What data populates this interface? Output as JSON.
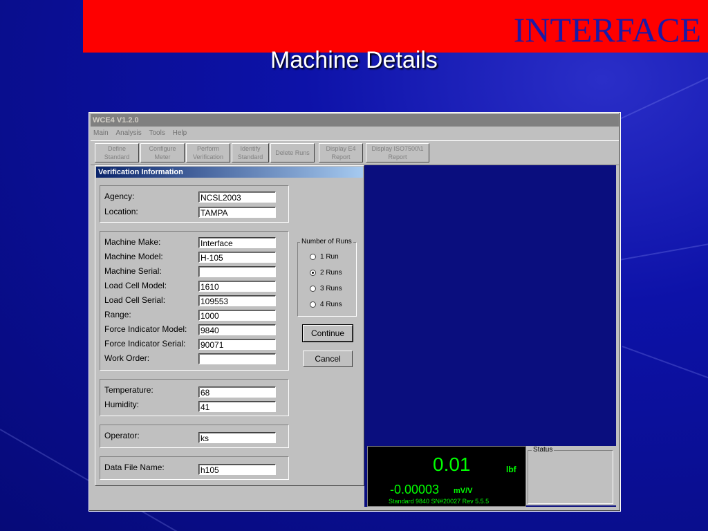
{
  "slide": {
    "brand": "INTERFACE",
    "title": "Machine Details"
  },
  "window": {
    "title": "WCE4 V1.2.0",
    "menu": [
      "Main",
      "Analysis",
      "Tools",
      "Help"
    ],
    "toolbar": [
      "Define\nStandard",
      "Configure\nMeter",
      "Perform\nVerification",
      "Identify\nStandard",
      "Delete Runs",
      "Display E4\nReport",
      "Display ISO7500\\1\nReport"
    ]
  },
  "panel": {
    "title": "Verification Information",
    "agency": {
      "label": "Agency:",
      "value": "NCSL2003"
    },
    "location": {
      "label": "Location:",
      "value": "TAMPA"
    },
    "machine_make": {
      "label": "Machine Make:",
      "value": "Interface"
    },
    "machine_model": {
      "label": "Machine Model:",
      "value": "H-105"
    },
    "machine_serial": {
      "label": "Machine Serial:",
      "value": ""
    },
    "load_cell_model": {
      "label": "Load Cell Model:",
      "value": "1610"
    },
    "load_cell_serial": {
      "label": "Load Cell Serial:",
      "value": "109553"
    },
    "range": {
      "label": "Range:",
      "value": "1000"
    },
    "force_indicator_model": {
      "label": "Force Indicator Model:",
      "value": "9840"
    },
    "force_indicator_serial": {
      "label": "Force Indicator Serial:",
      "value": "90071"
    },
    "work_order": {
      "label": "Work Order:",
      "value": ""
    },
    "temperature": {
      "label": "Temperature:",
      "value": "68"
    },
    "humidity": {
      "label": "Humidity:",
      "value": "41"
    },
    "operator": {
      "label": "Operator:",
      "value": "ks"
    },
    "data_file": {
      "label": "Data File Name:",
      "value": "h105"
    },
    "runs": {
      "legend": "Number of Runs",
      "options": [
        "1 Run",
        "2 Runs",
        "3 Runs",
        "4 Runs"
      ],
      "selected": "2 Runs"
    },
    "continue_label": "Continue",
    "cancel_label": "Cancel"
  },
  "readout": {
    "force_value": "0.01",
    "force_unit": "lbf",
    "signal_value": "-0.00003",
    "signal_unit": "mV/V",
    "info": "Standard 9840 SN#20027 Rev 5.5.5",
    "value_color": "#00ff00"
  },
  "status": {
    "legend": "Status"
  },
  "colors": {
    "brand_bar": "#fe0000",
    "brand_text": "#1a1aa6",
    "slide_bg": "#0d12a8"
  }
}
